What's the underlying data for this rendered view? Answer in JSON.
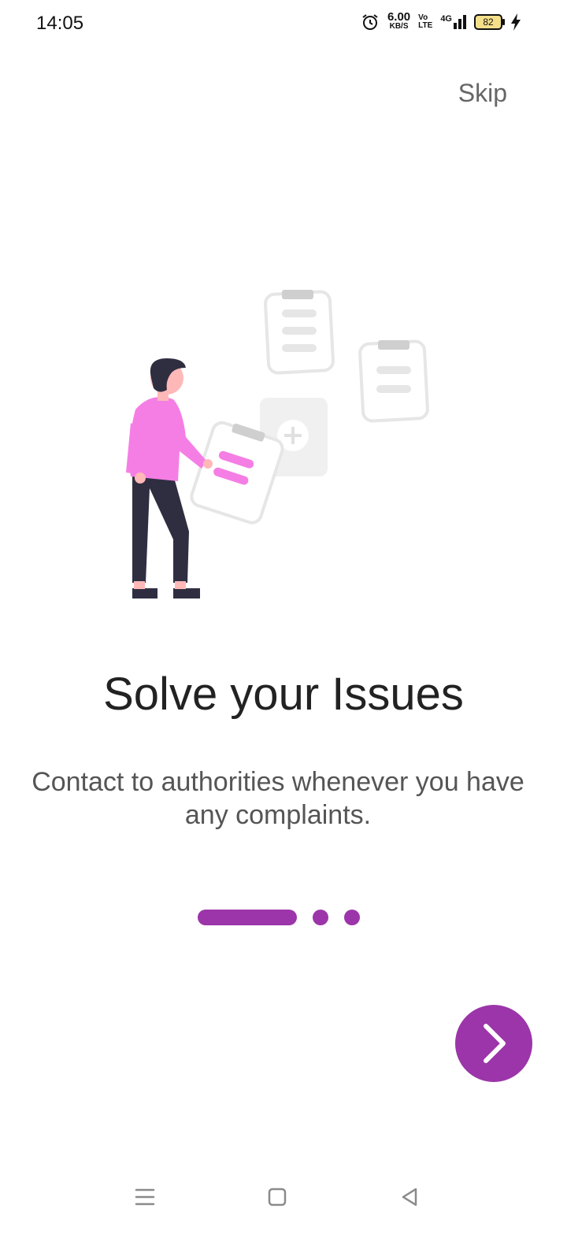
{
  "status_bar": {
    "time": "14:05",
    "speed_value": "6.00",
    "speed_unit": "KB/S",
    "volte_top": "Vo",
    "volte_bottom": "LTE",
    "network": "4G",
    "battery_level": "82",
    "icons": [
      "alarm-icon",
      "signal-icon",
      "battery-icon",
      "charging-icon"
    ]
  },
  "skip_label": "Skip",
  "onboarding": {
    "title": "Solve your Issues",
    "description": "Contact  to authorities whenever you have any complaints.",
    "total_pages": 3,
    "current_page": 1
  },
  "next_button": {
    "icon": "chevron-right-icon"
  },
  "nav_bar": {
    "items": [
      "menu-icon",
      "home-icon",
      "back-icon"
    ]
  },
  "colors": {
    "accent": "#9c35a9",
    "illustration_pink": "#f57ee5",
    "dark": "#2f2e41",
    "skin": "#ffb8b8",
    "light_gray": "#e6e6e6"
  }
}
